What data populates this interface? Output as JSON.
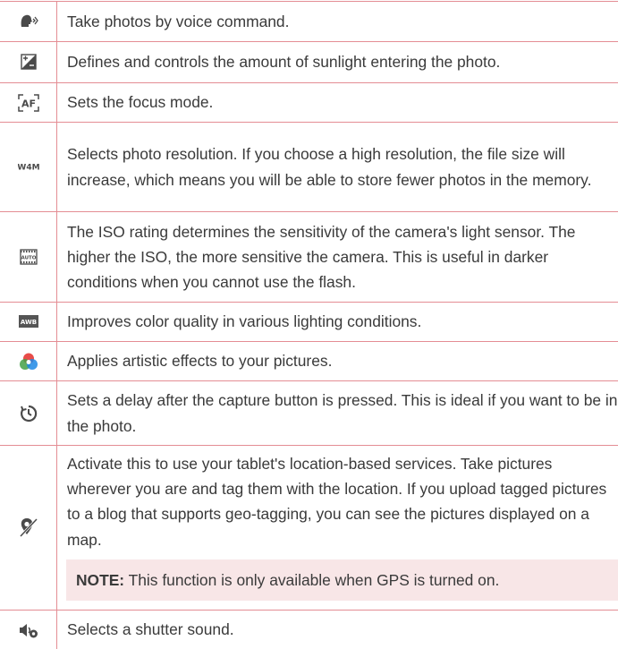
{
  "accent_color": "#e48d94",
  "note_background": "#f8e6e7",
  "rows": [
    {
      "icon": "voice-shutter-icon",
      "text": "Take photos by voice command."
    },
    {
      "icon": "brightness-icon",
      "text": "Defines and controls the amount of sunlight entering the photo."
    },
    {
      "icon": "focus-af-icon",
      "icon_label": "AF",
      "text": "Sets the focus mode."
    },
    {
      "icon": "resolution-w4m-icon",
      "icon_label": "W4M",
      "text": "Selects photo resolution. If you choose a high resolution, the file size will increase, which means you will be able to store fewer photos in the memory."
    },
    {
      "icon": "iso-icon",
      "icon_label": "AUTO",
      "text": "The ISO rating determines the sensitivity of the camera's light sensor. The higher the ISO, the more sensitive the camera. This is useful in darker conditions when you cannot use the flash."
    },
    {
      "icon": "white-balance-awb-icon",
      "icon_label": "AWB",
      "text": "Improves color quality in various lighting conditions."
    },
    {
      "icon": "color-effect-icon",
      "text": "Applies artistic effects to your pictures."
    },
    {
      "icon": "timer-icon",
      "text": "Sets a delay after the capture button is pressed. This is ideal if you want to be in the photo."
    },
    {
      "icon": "geotag-off-icon",
      "text": "Activate this to use your tablet's location-based services. Take pictures wherever you are and tag them with the location. If you upload tagged pictures to a blog that supports geo-tagging, you can see the pictures displayed on a map.",
      "note_label": "NOTE:",
      "note_text": "This function is only available when GPS is turned on."
    },
    {
      "icon": "shutter-sound-icon",
      "text": "Selects a shutter sound."
    }
  ]
}
